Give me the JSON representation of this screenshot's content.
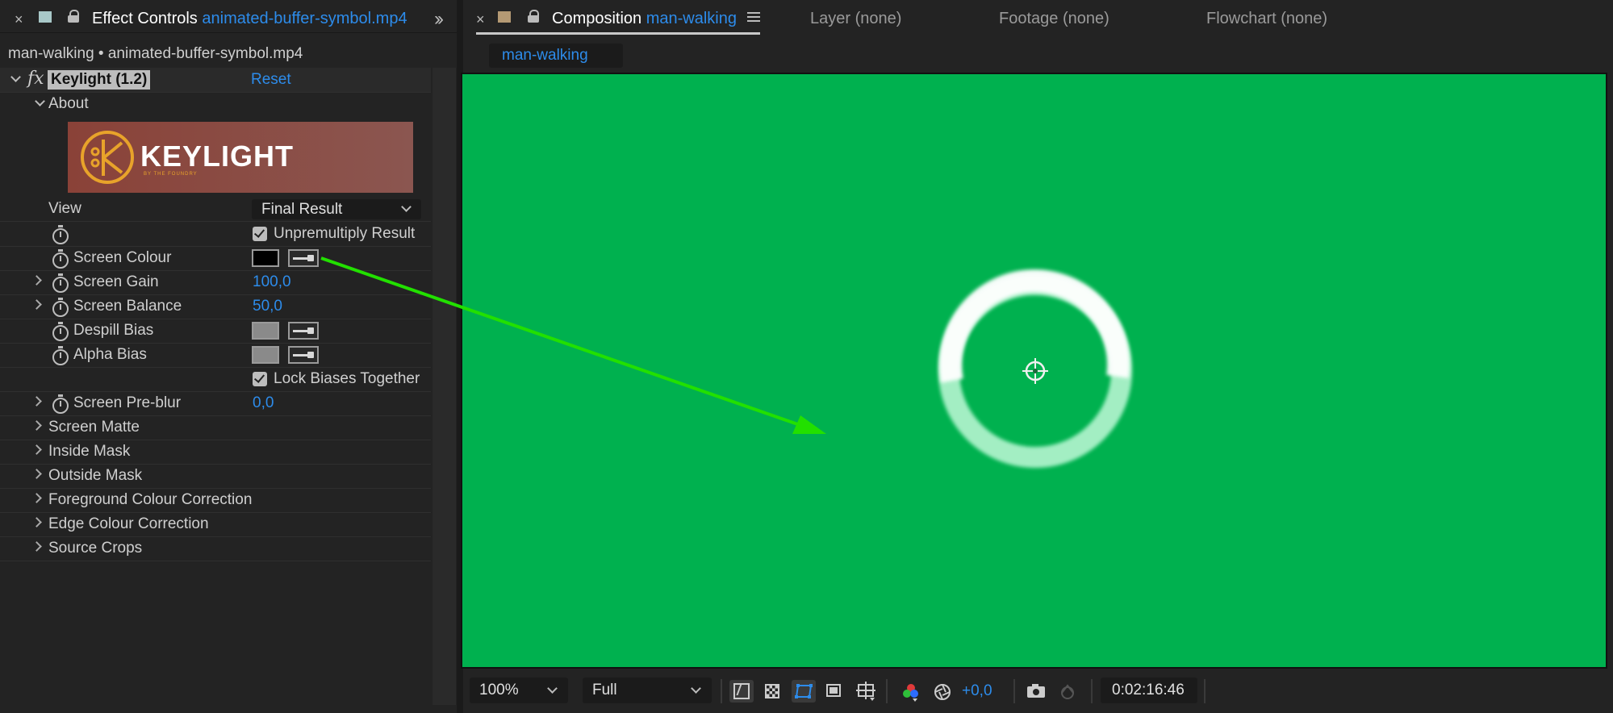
{
  "effect_controls_tab": {
    "title_prefix": "Effect Controls",
    "title_file": "animated-buffer-symbol.mp4",
    "breadcrumb": "man-walking • animated-buffer-symbol.mp4"
  },
  "effect": {
    "fx_label": "fx",
    "name": "Keylight (1.2)",
    "reset_label": "Reset",
    "about_label": "About",
    "logo_text": "KEYLIGHT",
    "logo_subtext": "BY THE FOUNDRY"
  },
  "properties": {
    "view_label": "View",
    "view_value": "Final Result",
    "unpremultiply_label": "Unpremultiply Result",
    "screen_colour_label": "Screen Colour",
    "screen_gain_label": "Screen Gain",
    "screen_gain_value": "100,0",
    "screen_balance_label": "Screen Balance",
    "screen_balance_value": "50,0",
    "despill_bias_label": "Despill Bias",
    "alpha_bias_label": "Alpha Bias",
    "lock_biases_label": "Lock Biases Together",
    "screen_preblur_label": "Screen Pre-blur",
    "screen_preblur_value": "0,0",
    "groups": [
      "Screen Matte",
      "Inside Mask",
      "Outside Mask",
      "Foreground Colour Correction",
      "Edge Colour Correction",
      "Source Crops"
    ]
  },
  "composition_tab": {
    "title_prefix": "Composition",
    "title_name": "man-walking",
    "subtab": "man-walking"
  },
  "other_tabs": {
    "layer": "Layer (none)",
    "footage": "Footage (none)",
    "flowchart": "Flowchart (none)"
  },
  "toolbar": {
    "zoom": "100%",
    "resolution": "Full",
    "exposure": "+0,0",
    "timecode": "0:02:16:46"
  },
  "colors": {
    "green_screen": "#00b14f",
    "accent_blue": "#2d8ceb",
    "arrow_green": "#22e000"
  }
}
